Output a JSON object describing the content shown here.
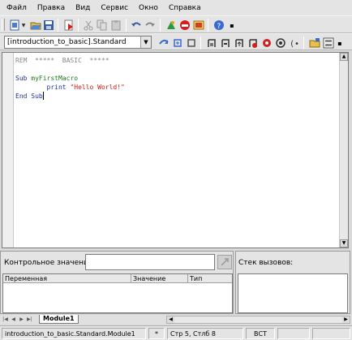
{
  "menu": [
    {
      "label": "Файл"
    },
    {
      "label": "Правка"
    },
    {
      "label": "Вид"
    },
    {
      "label": "Сервис"
    },
    {
      "label": "Окно"
    },
    {
      "label": "Справка"
    }
  ],
  "library_combo": {
    "value": "[introduction_to_basic].Standard"
  },
  "code": {
    "line1": "REM  *****  BASIC  *****",
    "line3_kw": "Sub",
    "line3_name": "myFirstMacro",
    "line4_indent": "        print ",
    "line4_str": "\"Hello World!\"",
    "line5": "End Sub"
  },
  "watch": {
    "label": "Контрольное значение:",
    "input_value": "",
    "columns": [
      "Переменная",
      "Значение",
      "Тип"
    ]
  },
  "callstack": {
    "label": "Стек вызовов:"
  },
  "tabs": [
    {
      "label": "Module1"
    }
  ],
  "status": {
    "module": "introduction_to_basic.Standard.Module1",
    "modified": "*",
    "position": "Стр 5, Стлб 8",
    "mode": "ВСТ"
  },
  "colors": {
    "keyword": "#1d2fa8",
    "identifier": "#1d7a1d",
    "string": "#c81a1a",
    "comment": "#8a8a8a"
  },
  "icons": {
    "toolbar1": [
      "new-icon",
      "open-icon",
      "save-icon",
      "export-icon",
      "cut-icon",
      "copy-icon",
      "paste-icon",
      "undo-icon",
      "redo-icon",
      "navigator-icon",
      "gallery-icon",
      "datasource-icon",
      "help-icon"
    ],
    "toolbar2": [
      "compile-icon",
      "run-icon",
      "stop-icon",
      "step-into-icon",
      "step-over-icon",
      "step-out-icon",
      "breakpoint-icon",
      "manage-breakpoints-icon",
      "watch-icon",
      "find-parentheses-icon",
      "select-macro-icon",
      "select-module-icon"
    ]
  }
}
